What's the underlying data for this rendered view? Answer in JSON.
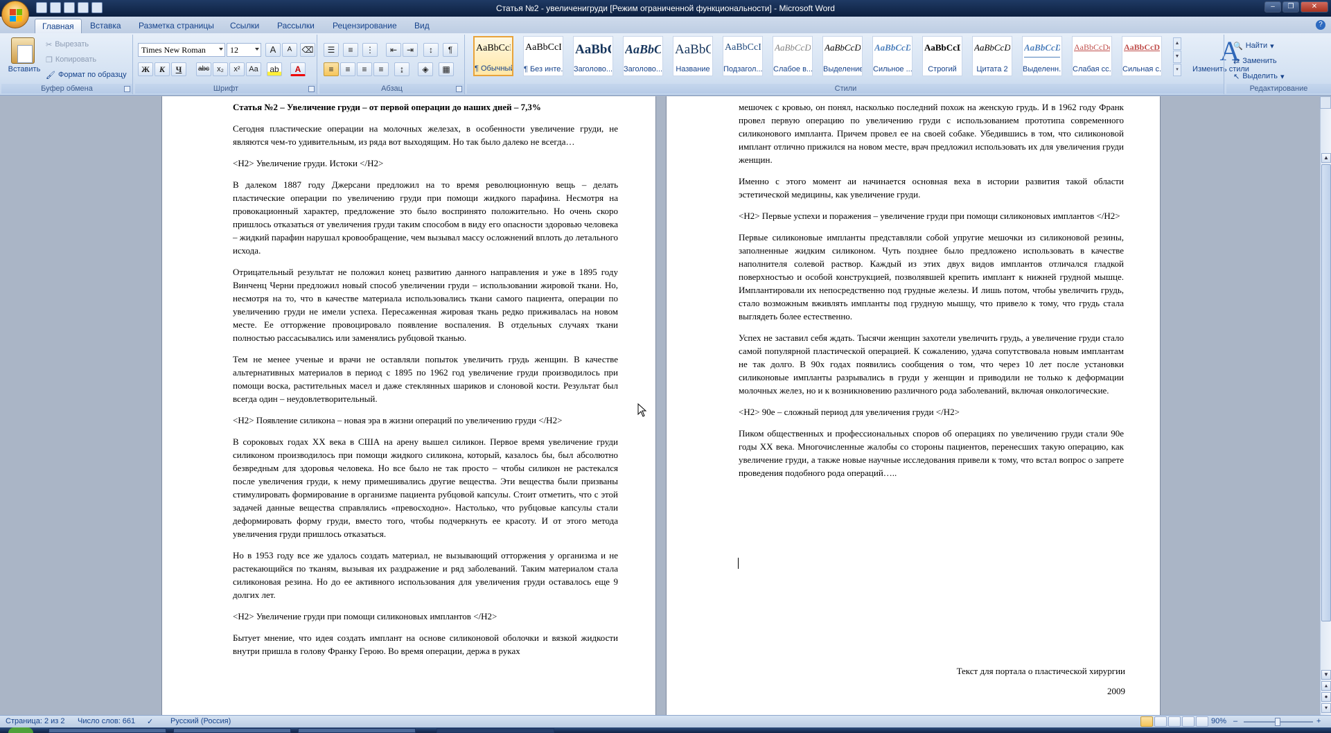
{
  "window": {
    "title": "Статья №2 - увеличенигруди [Режим ограниченной функциональности] - Microsoft Word",
    "controls": {
      "minimize": "–",
      "maximize": "❐",
      "close": "✕"
    }
  },
  "tabs": [
    {
      "label": "Главная",
      "active": true
    },
    {
      "label": "Вставка"
    },
    {
      "label": "Разметка страницы"
    },
    {
      "label": "Ссылки"
    },
    {
      "label": "Рассылки"
    },
    {
      "label": "Рецензирование"
    },
    {
      "label": "Вид"
    }
  ],
  "ribbon": {
    "clipboard": {
      "label": "Буфер обмена",
      "paste": "Вставить",
      "cut": "Вырезать",
      "copy": "Копировать",
      "format_painter": "Формат по образцу"
    },
    "font": {
      "label": "Шрифт",
      "font_name": "Times New Roman",
      "font_size": "12",
      "grow": "A",
      "shrink": "A",
      "bold": "Ж",
      "italic": "К",
      "underline": "Ч",
      "strike": "abc",
      "subscript": "x₂",
      "superscript": "x²",
      "change_case": "Aa",
      "font_color": "A"
    },
    "paragraph": {
      "label": "Абзац",
      "pilcrow": "¶"
    },
    "styles": {
      "label": "Стили",
      "items": [
        {
          "preview": "AaBbCcDc",
          "name": "¶ Обычный",
          "active": true
        },
        {
          "preview": "AaBbCcDc",
          "name": "¶ Без инте..."
        },
        {
          "preview": "AaBbC",
          "name": "Заголово..."
        },
        {
          "preview": "AaBbC",
          "name": "Заголово..."
        },
        {
          "preview": "AaBbC",
          "name": "Название"
        },
        {
          "preview": "AaBbCcI",
          "name": "Подзагол..."
        },
        {
          "preview": "AaBbCcDc",
          "name": "Слабое в..."
        },
        {
          "preview": "AaBbCcDc",
          "name": "Выделение"
        },
        {
          "preview": "AaBbCcDc",
          "name": "Сильное ..."
        },
        {
          "preview": "AaBbCcDc",
          "name": "Строгий"
        },
        {
          "preview": "AaBbCcDc",
          "name": "Цитата 2"
        },
        {
          "preview": "AaBbCcDc",
          "name": "Выделенн..."
        },
        {
          "preview": "AaBbCcDc",
          "name": "Слабая сс..."
        },
        {
          "preview": "AaBbCcDc",
          "name": "Сильная с..."
        }
      ],
      "change_styles": "Изменить стили"
    },
    "editing": {
      "label": "Редактирование",
      "find": "Найти",
      "replace": "Заменить",
      "select": "Выделить"
    }
  },
  "document": {
    "left_page": [
      {
        "text": "Статья №2 – Увеличение груди – от первой операции до наших дней – 7,3%",
        "bold": true
      },
      {
        "text": "Сегодня пластические операции на молочных железах, в особенности увеличение груди, не являются чем-то удивительным, из ряда вот выходящим. Но так было далеко не всегда…"
      },
      {
        "text": "<H2> Увеличение груди. Истоки </H2>"
      },
      {
        "text": "В далеком 1887 году Джерсани предложил на то время революционную вещь – делать пластические операции по увеличению груди при помощи жидкого парафина. Несмотря на провокационный характер, предложение это было воспринято положительно. Но очень скоро пришлось отказаться от увеличения груди таким способом в виду его опасности здоровью человека – жидкий парафин нарушал кровообращение, чем вызывал массу осложнений вплоть до летального исхода."
      },
      {
        "text": "Отрицательный результат не положил конец развитию данного направления и уже в 1895 году Винченц Черни предложил новый способ увеличении груди – использовании жировой ткани. Но, несмотря на то, что в качестве материала использовались ткани самого пациента, операции по увеличению груди не имели успеха. Пересаженная жировая ткань редко приживалась на новом месте. Ее отторжение провоцировало появление воспаления. В отдельных случаях ткани полностью рассасывались или заменялись рубцовой тканью."
      },
      {
        "text": "Тем не менее ученые и врачи не оставляли попыток увеличить грудь женщин. В качестве альтернативных материалов в период с 1895 по 1962 год увеличение груди производилось при помощи воска, растительных масел и даже стеклянных шариков и слоновой кости. Результат был всегда один – неудовлетворительный."
      },
      {
        "text": "<H2> Появление силикона – новая эра в жизни операций по увеличению груди </H2>"
      },
      {
        "text": "В сороковых годах XX века в США на арену вышел силикон. Первое время увеличение груди силиконом производилось при помощи жидкого силикона, который, казалось бы, был абсолютно безвредным для здоровья человека. Но все было не так просто – чтобы силикон не растекался после увеличения груди, к нему примешивались другие вещества. Эти вещества были призваны стимулировать формирование в организме пациента рубцовой капсулы. Стоит отметить, что с этой задачей данные вещества справлялись «превосходно». Настолько, что рубцовые капсулы стали деформировать форму груди, вместо того, чтобы подчеркнуть ее красоту. И от этого метода увеличения груди пришлось отказаться."
      },
      {
        "text": "Но в 1953 году все же удалось создать материал, не вызывающий отторжения у организма и не растекающийся по тканям, вызывая их раздражение и ряд заболеваний. Таким материалом стала силиконовая резина. Но до ее активного использования для увеличения груди оставалось еще 9 долгих лет."
      },
      {
        "text": "<H2> Увеличение груди при помощи силиконовых имплантов </H2>"
      },
      {
        "text": "Бытует мнение, что идея создать имплант на основе силиконовой оболочки и вязкой жидкости внутри пришла в голову Франку Герою. Во время операции, держа в руках"
      }
    ],
    "right_page": [
      {
        "text": "мешочек с кровью, он понял, насколько последний похож на женскую грудь. И в 1962 году Франк провел первую операцию по увеличению груди с использованием прототипа современного силиконового импланта. Причем провел ее на своей собаке. Убедившись в том, что силиконовой имплант отлично прижился на новом месте, врач предложил использовать их для увеличения груди женщин."
      },
      {
        "text": "Именно с этого момент аи начинается основная веха в истории развития такой области эстетической медицины, как увеличение груди."
      },
      {
        "text": "<H2> Первые успехи и поражения – увеличение груди при помощи силиконовых имплантов </H2>"
      },
      {
        "text": "Первые силиконовые импланты представляли собой упругие мешочки из силиконовой резины, заполненные жидким силиконом. Чуть позднее было предложено использовать в качестве наполнителя солевой раствор. Каждый из этих двух видов имплантов отличался гладкой поверхностью и особой конструкцией, позволявшей крепить имплант к нижней грудной мышце. Имплантировали их непосредственно под грудные железы. И лишь потом, чтобы увеличить грудь, стало возможным вживлять импланты под грудную мышцу, что привело к тому, что грудь стала выглядеть более естественно."
      },
      {
        "text": "Успех не заставил себя ждать. Тысячи женщин захотели увеличить грудь, а увеличение груди стало самой популярной пластической операцией. К сожалению, удача сопутствовала новым имплантам не так долго. В 90х годах появились сообщения о том, что через 10 лет после установки силиконовые импланты разрывались в груди у женщин и приводили не только к деформации молочных желез, но и к возникновению различного рода заболеваний, включая онкологические."
      },
      {
        "text": "<H2> 90е – сложный период для увеличения груди </H2>"
      },
      {
        "text": "Пиком общественных и профессиональных споров об операциях по увеличению груди стали 90е годы XX века. Многочисленные жалобы со стороны пациентов, перенесших такую операцию, как увеличение груди, а также новые научные исследования привели к тому, что встал вопрос о запрете проведения подобного рода операций….."
      }
    ],
    "footer_caption": "Текст для портала о пластической хирургии",
    "footer_year": "2009"
  },
  "status": {
    "page": "Страница: 2 из 2",
    "words": "Число слов: 661",
    "language": "Русский (Россия)",
    "zoom": "90%",
    "zoom_minus": "–",
    "zoom_plus": "+"
  },
  "colors": {
    "ribbon_text": "#15428b",
    "accent": "#e8a33a",
    "title_bar": "#1f3a64"
  }
}
